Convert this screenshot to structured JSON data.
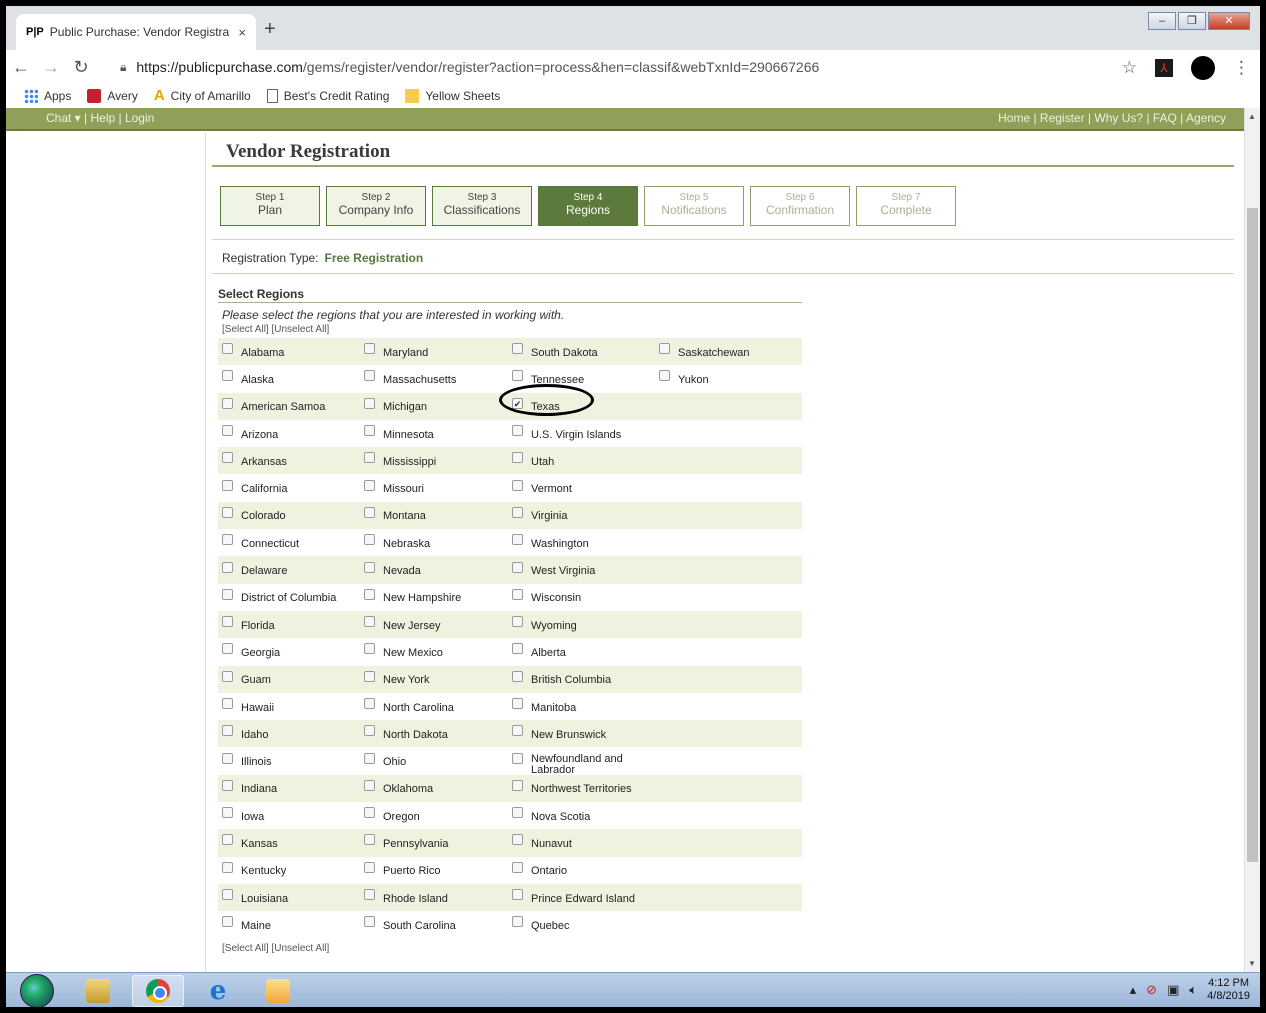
{
  "browser": {
    "tab_favicon": "P|P",
    "tab_title": "Public Purchase: Vendor Registra",
    "tab_close": "×",
    "new_tab": "+",
    "url_host": "https://publicpurchase.com",
    "url_path": "/gems/register/vendor/register?action=process&hen=classif&webTxnId=290667266",
    "bookmarks": [
      {
        "label": "Apps",
        "icon": "apps-icon"
      },
      {
        "label": "Avery",
        "icon": "avery-icon"
      },
      {
        "label": "City of Amarillo",
        "icon": "amarillo-icon"
      },
      {
        "label": "Best's Credit Rating",
        "icon": "document-icon"
      },
      {
        "label": "Yellow Sheets",
        "icon": "folder-icon"
      }
    ]
  },
  "site_nav": {
    "left": "Chat ▾ | Help | Login",
    "right": "Home | Register | Why Us? | FAQ | Agency"
  },
  "page": {
    "title": "Vendor Registration",
    "steps": [
      {
        "num": "Step 1",
        "label": "Plan",
        "state": "done"
      },
      {
        "num": "Step 2",
        "label": "Company Info",
        "state": "done"
      },
      {
        "num": "Step 3",
        "label": "Classifications",
        "state": "done"
      },
      {
        "num": "Step 4",
        "label": "Regions",
        "state": "active"
      },
      {
        "num": "Step 5",
        "label": "Notifications",
        "state": "future"
      },
      {
        "num": "Step 6",
        "label": "Confirmation",
        "state": "future"
      },
      {
        "num": "Step 7",
        "label": "Complete",
        "state": "future"
      }
    ],
    "registration_type_label": "Registration Type:",
    "registration_type_value": "Free Registration",
    "select_regions_heading": "Select Regions",
    "instructions": "Please select the regions that you are interested in working with.",
    "select_all": "[Select All]",
    "unselect_all": "[Unselect All]"
  },
  "regions": [
    [
      "Alabama",
      "Maryland",
      "South Dakota",
      "Saskatchewan"
    ],
    [
      "Alaska",
      "Massachusetts",
      "Tennessee",
      "Yukon"
    ],
    [
      "American Samoa",
      "Michigan",
      "Texas",
      ""
    ],
    [
      "Arizona",
      "Minnesota",
      "U.S. Virgin Islands",
      ""
    ],
    [
      "Arkansas",
      "Mississippi",
      "Utah",
      ""
    ],
    [
      "California",
      "Missouri",
      "Vermont",
      ""
    ],
    [
      "Colorado",
      "Montana",
      "Virginia",
      ""
    ],
    [
      "Connecticut",
      "Nebraska",
      "Washington",
      ""
    ],
    [
      "Delaware",
      "Nevada",
      "West Virginia",
      ""
    ],
    [
      "District of Columbia",
      "New Hampshire",
      "Wisconsin",
      ""
    ],
    [
      "Florida",
      "New Jersey",
      "Wyoming",
      ""
    ],
    [
      "Georgia",
      "New Mexico",
      "Alberta",
      ""
    ],
    [
      "Guam",
      "New York",
      "British Columbia",
      ""
    ],
    [
      "Hawaii",
      "North Carolina",
      "Manitoba",
      ""
    ],
    [
      "Idaho",
      "North Dakota",
      "New Brunswick",
      ""
    ],
    [
      "Illinois",
      "Ohio",
      "Newfoundland and Labrador",
      ""
    ],
    [
      "Indiana",
      "Oklahoma",
      "Northwest Territories",
      ""
    ],
    [
      "Iowa",
      "Oregon",
      "Nova Scotia",
      ""
    ],
    [
      "Kansas",
      "Pennsylvania",
      "Nunavut",
      ""
    ],
    [
      "Kentucky",
      "Puerto Rico",
      "Ontario",
      ""
    ],
    [
      "Louisiana",
      "Rhode Island",
      "Prince Edward Island",
      ""
    ],
    [
      "Maine",
      "South Carolina",
      "Quebec",
      ""
    ]
  ],
  "checked_regions": [
    "Texas"
  ],
  "taskbar": {
    "time": "4:12 PM",
    "date": "4/8/2019"
  },
  "colors": {
    "accent_green": "#5d7a3d",
    "row_alt": "#eef3df",
    "nav_strip": "#8fa05a"
  }
}
